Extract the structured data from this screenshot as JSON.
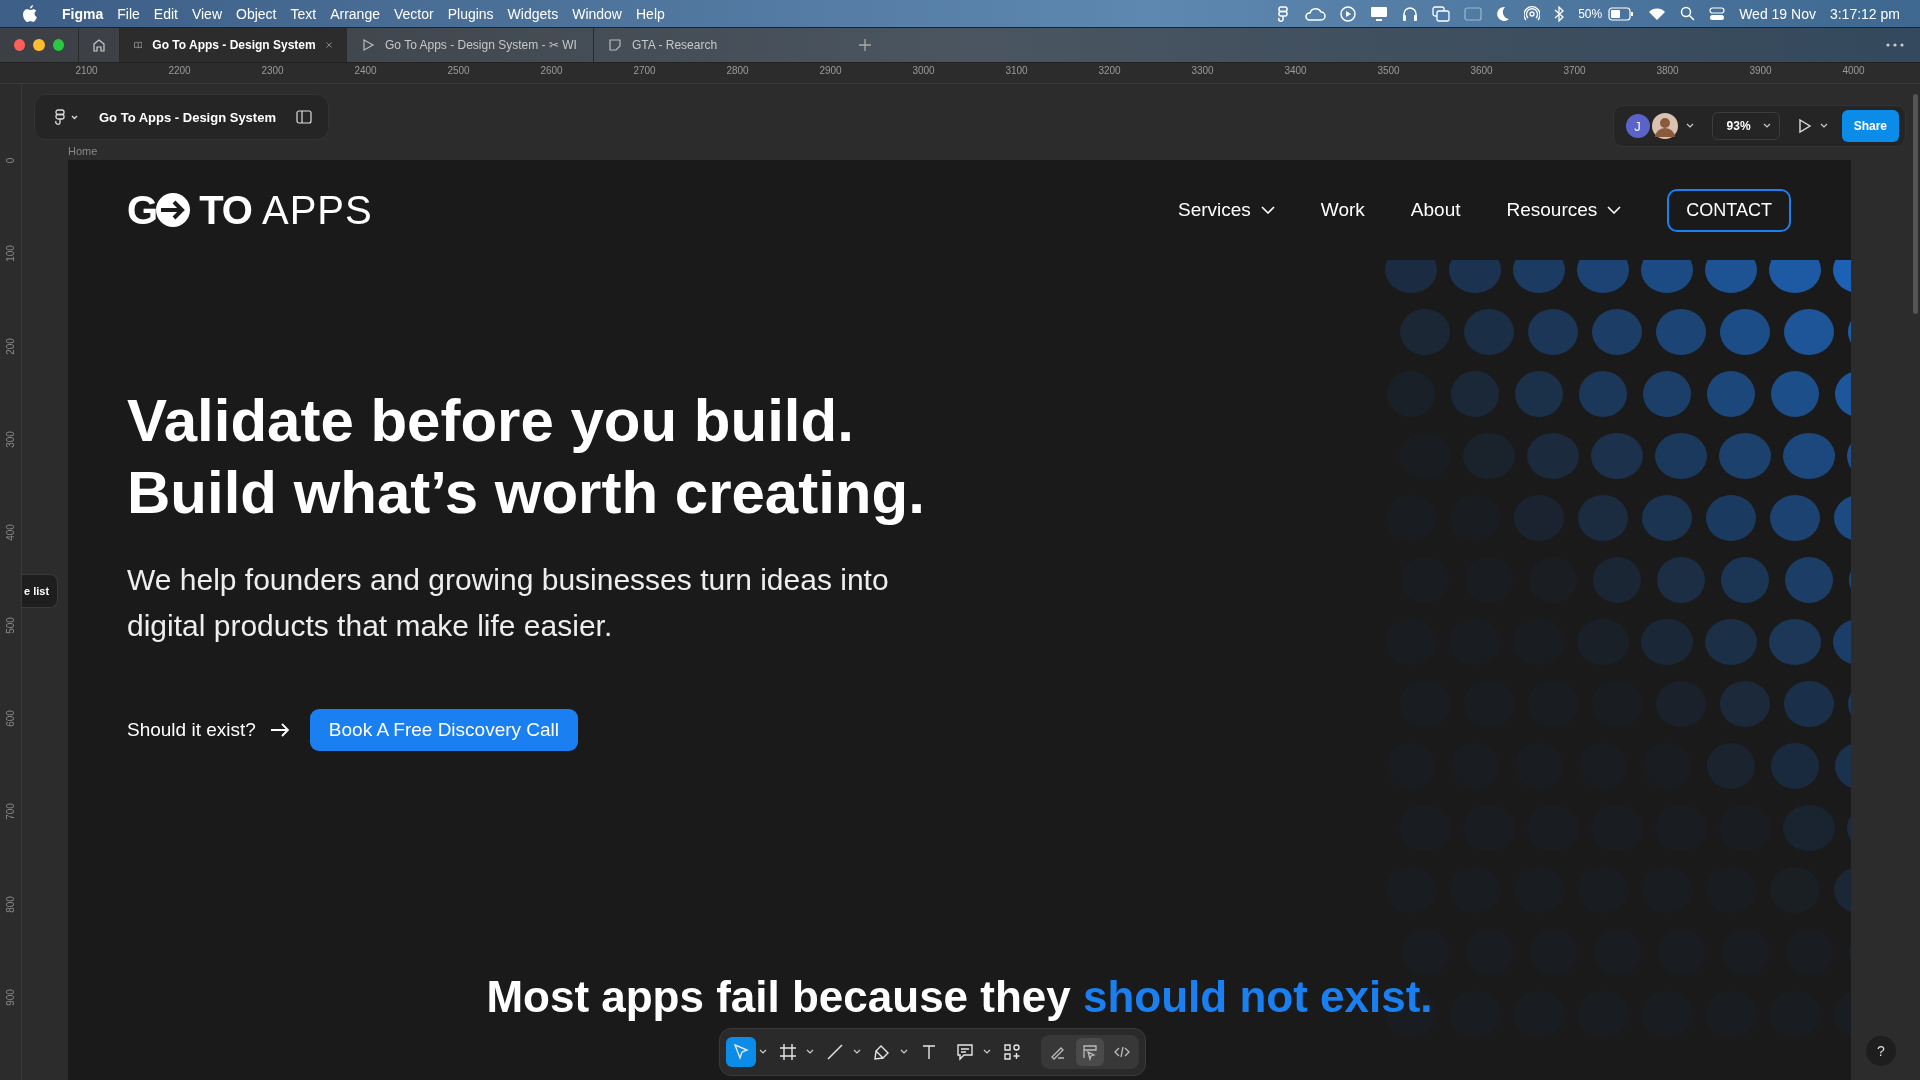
{
  "menubar": {
    "app": "Figma",
    "menus": [
      "File",
      "Edit",
      "View",
      "Object",
      "Text",
      "Arrange",
      "Vector",
      "Plugins",
      "Widgets",
      "Window",
      "Help"
    ],
    "battery": "50%",
    "date": "Wed 19 Nov",
    "time": "3:17:12 pm"
  },
  "tabs": [
    {
      "kind": "design",
      "label": "Go To Apps - Design System",
      "selected": true
    },
    {
      "kind": "prototype",
      "label": "Go To Apps - Design System - ✂ WI",
      "selected": false
    },
    {
      "kind": "figjam",
      "label": "GTA - Research",
      "selected": false
    }
  ],
  "rulers": {
    "horizontal": [
      "2100",
      "2200",
      "2300",
      "2400",
      "2500",
      "2600",
      "2700",
      "2800",
      "2900",
      "3000",
      "3100",
      "3200",
      "3300",
      "3400",
      "3500",
      "3600",
      "3700",
      "3800",
      "3900",
      "4000"
    ],
    "vertical": [
      "0",
      "100",
      "200",
      "300",
      "400",
      "500",
      "600",
      "700",
      "800",
      "900"
    ]
  },
  "file": {
    "title": "Go To Apps - Design System",
    "page_label": "Home"
  },
  "collab": {
    "avatar_initial": "J",
    "zoom": "93%",
    "share": "Share"
  },
  "side_tab": "e list",
  "site": {
    "logo": [
      "G",
      "TO",
      "APPS"
    ],
    "nav": [
      {
        "label": "Services",
        "has_menu": true
      },
      {
        "label": "Work",
        "has_menu": false
      },
      {
        "label": "About",
        "has_menu": false
      },
      {
        "label": "Resources",
        "has_menu": true
      }
    ],
    "contact": "CONTACT",
    "headline": [
      "Validate before you build.",
      "Build what’s worth creating."
    ],
    "subtitle": "We help founders and growing businesses turn ideas into digital products that make life easier.",
    "prompt": "Should it exist?",
    "cta": "Book A Free Discovery Call",
    "section_heading": {
      "text": "Most apps fail because they ",
      "highlight": "should not exist."
    }
  },
  "tools": [
    {
      "kind": "move",
      "selected": true,
      "menu": true
    },
    {
      "kind": "frame",
      "selected": false,
      "menu": true
    },
    {
      "kind": "line",
      "selected": false,
      "menu": true
    },
    {
      "kind": "pen",
      "selected": false,
      "menu": true
    },
    {
      "kind": "text",
      "selected": false,
      "menu": false
    },
    {
      "kind": "comment",
      "selected": false,
      "menu": true
    },
    {
      "kind": "actions",
      "selected": false,
      "menu": false
    }
  ],
  "modes": [
    {
      "kind": "draw",
      "selected": false
    },
    {
      "kind": "design",
      "selected": true
    },
    {
      "kind": "dev",
      "selected": false
    }
  ],
  "help": "?"
}
